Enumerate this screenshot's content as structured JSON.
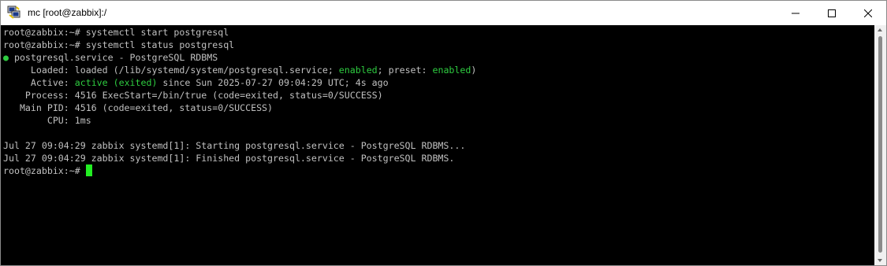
{
  "window": {
    "title": "mc [root@zabbix]:/",
    "app_icon": "putty-icon"
  },
  "controls": {
    "minimize": "minimize-icon",
    "maximize": "maximize-icon",
    "close": "close-icon"
  },
  "terminal": {
    "lines": {
      "l0": {
        "a": "root@zabbix:~# systemctl start postgresql"
      },
      "l1": {
        "a": "root@zabbix:~# systemctl status postgresql"
      },
      "l2": {
        "bullet": "●",
        "a": " postgresql.service - PostgreSQL RDBMS"
      },
      "l3": {
        "a": "     Loaded: loaded (/lib/systemd/system/postgresql.service; ",
        "b": "enabled",
        "c": "; preset: ",
        "d": "enabled",
        "e": ")"
      },
      "l4": {
        "a": "     Active: ",
        "b": "active (exited)",
        "c": " since Sun 2025-07-27 09:04:29 UTC; 4s ago"
      },
      "l5": {
        "a": "    Process: 4516 ExecStart=/bin/true (code=exited, status=0/SUCCESS)"
      },
      "l6": {
        "a": "   Main PID: 4516 (code=exited, status=0/SUCCESS)"
      },
      "l7": {
        "a": "        CPU: 1ms"
      },
      "l8": {
        "a": ""
      },
      "l9": {
        "a": "Jul 27 09:04:29 zabbix systemd[1]: Starting postgresql.service - PostgreSQL RDBMS..."
      },
      "l10": {
        "a": "Jul 27 09:04:29 zabbix systemd[1]: Finished postgresql.service - PostgreSQL RDBMS."
      },
      "l11": {
        "a": "root@zabbix:~# "
      }
    },
    "colors": {
      "background": "#000000",
      "text": "#c0c0c0",
      "green": "#2ecc40",
      "cursor": "#22ee22"
    }
  }
}
